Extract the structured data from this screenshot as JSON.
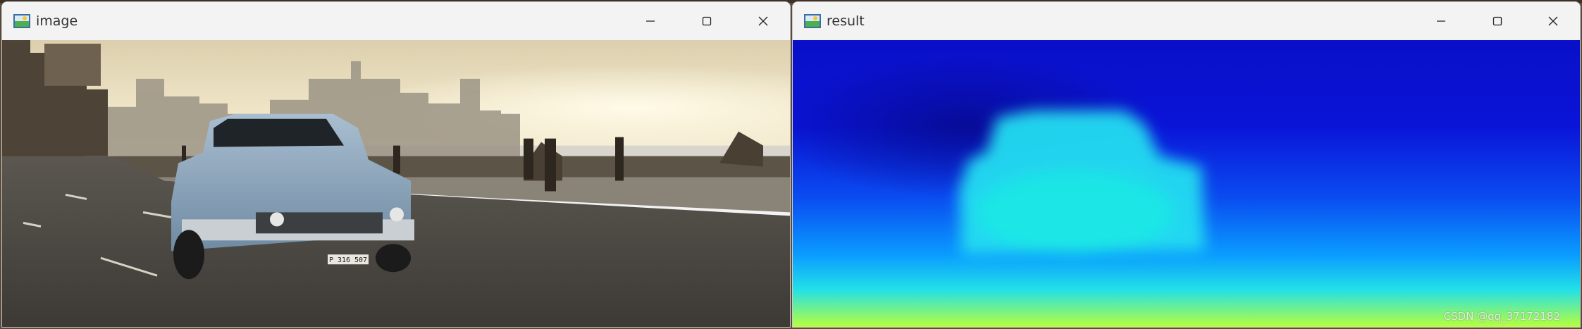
{
  "windows": [
    {
      "id": "image",
      "title": "image"
    },
    {
      "id": "result",
      "title": "result"
    }
  ],
  "controls": {
    "minimize": "minimize-icon",
    "maximize": "maximize-icon",
    "close": "close-icon"
  },
  "image_content": {
    "car_plate": "P 316 507"
  },
  "result_content": {
    "colormap": "jet"
  },
  "watermark": "CSDN @qq_37172182",
  "colors": {
    "titlebar": "#f3f3f3",
    "depth_far": "#0a10c8",
    "depth_mid": "#0a78ff",
    "depth_near": "#a8ff4a",
    "car_depth": "#22dcf0"
  }
}
